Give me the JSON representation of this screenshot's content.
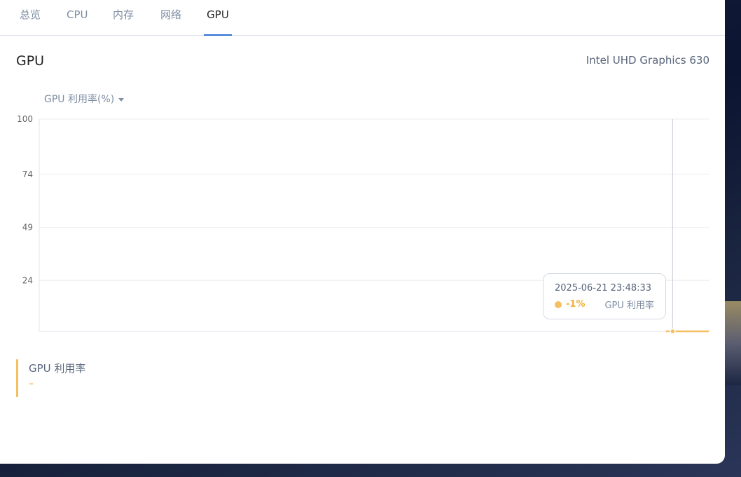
{
  "tabs": [
    {
      "label": "总览"
    },
    {
      "label": "CPU"
    },
    {
      "label": "内存"
    },
    {
      "label": "网络"
    },
    {
      "label": "GPU"
    }
  ],
  "active_tab": "GPU",
  "section": {
    "title": "GPU",
    "device": "Intel UHD Graphics 630"
  },
  "metric_selector": {
    "selected": "GPU 利用率(%)"
  },
  "tooltip": {
    "time": "2025-06-21 23:48:33",
    "value": "-1%",
    "series": "GPU 利用率"
  },
  "legend_card": {
    "name": "GPU 利用率",
    "value": "–"
  },
  "colors": {
    "series": "#f5c061",
    "accent": "#2b6fd6"
  },
  "chart_data": {
    "type": "line",
    "title": "",
    "xlabel": "",
    "ylabel": "",
    "ylim": [
      0,
      100
    ],
    "yticks": [
      24,
      49,
      74,
      100
    ],
    "grid": true,
    "series": [
      {
        "name": "GPU 利用率",
        "x": [
          0.935,
          0.999
        ],
        "values": [
          0,
          0
        ]
      }
    ],
    "hover_x": 0.945
  }
}
